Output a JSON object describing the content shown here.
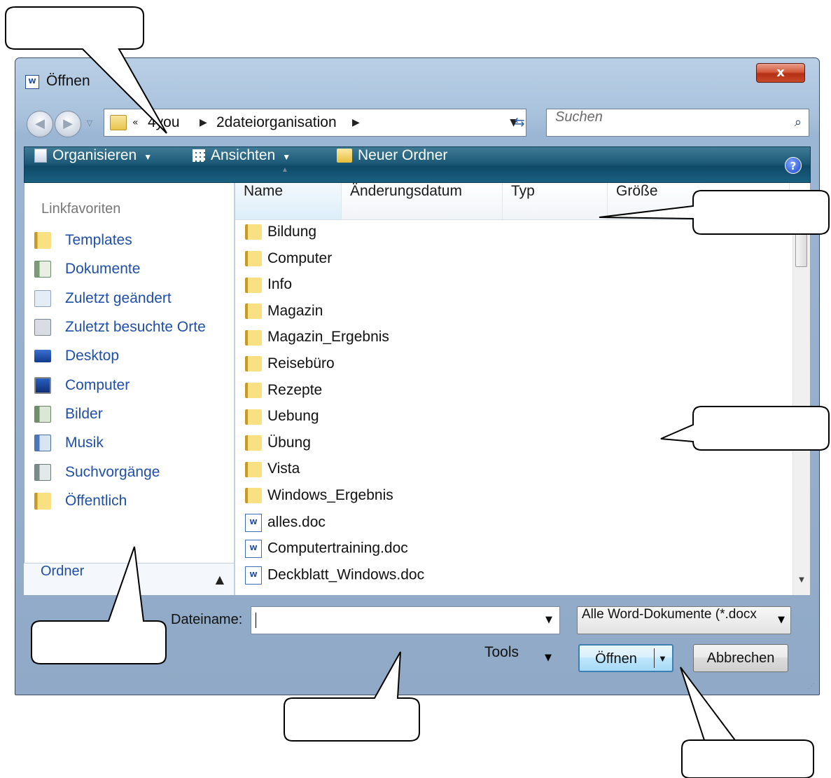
{
  "window": {
    "title": "Öffnen",
    "app_icon": "word-icon",
    "close_label": "x"
  },
  "navigation": {
    "back_icon": "back-arrow-icon",
    "forward_icon": "forward-arrow-icon",
    "breadcrumb": [
      "4you",
      "2dateiorganisation"
    ],
    "search_placeholder": "Suchen"
  },
  "toolbar": {
    "organize": "Organisieren",
    "views": "Ansichten",
    "new_folder": "Neuer Ordner",
    "help": "?"
  },
  "sidebar": {
    "heading": "Linkfavoriten",
    "items": [
      {
        "label": "Templates",
        "icon": "folder-icon"
      },
      {
        "label": "Dokumente",
        "icon": "documents-icon"
      },
      {
        "label": "Zuletzt geändert",
        "icon": "recent-changed-icon"
      },
      {
        "label": "Zuletzt besuchte Orte",
        "icon": "recent-places-icon"
      },
      {
        "label": "Desktop",
        "icon": "desktop-icon"
      },
      {
        "label": "Computer",
        "icon": "computer-icon"
      },
      {
        "label": "Bilder",
        "icon": "pictures-icon"
      },
      {
        "label": "Musik",
        "icon": "music-icon"
      },
      {
        "label": "Suchvorgänge",
        "icon": "searches-icon"
      },
      {
        "label": "Öffentlich",
        "icon": "public-folder-icon"
      }
    ],
    "folders_label": "Ordner"
  },
  "filelist": {
    "columns": [
      "Name",
      "Änderungsdatum",
      "Typ",
      "Größe"
    ],
    "items": [
      {
        "name": "Bildung",
        "type": "folder"
      },
      {
        "name": "Computer",
        "type": "folder"
      },
      {
        "name": "Info",
        "type": "folder"
      },
      {
        "name": "Magazin",
        "type": "folder"
      },
      {
        "name": "Magazin_Ergebnis",
        "type": "folder"
      },
      {
        "name": "Reisebüro",
        "type": "folder"
      },
      {
        "name": "Rezepte",
        "type": "folder"
      },
      {
        "name": "Uebung",
        "type": "folder"
      },
      {
        "name": "Übung",
        "type": "folder"
      },
      {
        "name": "Vista",
        "type": "folder"
      },
      {
        "name": "Windows_Ergebnis",
        "type": "folder"
      },
      {
        "name": "alles.doc",
        "type": "doc"
      },
      {
        "name": "Computertraining.doc",
        "type": "doc"
      },
      {
        "name": "Deckblatt_Windows.doc",
        "type": "doc"
      }
    ]
  },
  "footer": {
    "filename_label": "Dateiname:",
    "filename_value": "",
    "filter_value": "Alle Word-Dokumente (*.docx",
    "tools_label": "Tools",
    "open_label": "Öffnen",
    "cancel_label": "Abbrechen"
  },
  "colors": {
    "link_blue": "#1f4fa8",
    "toolbar_teal": "#1d5a78",
    "close_red": "#c84a2b"
  }
}
